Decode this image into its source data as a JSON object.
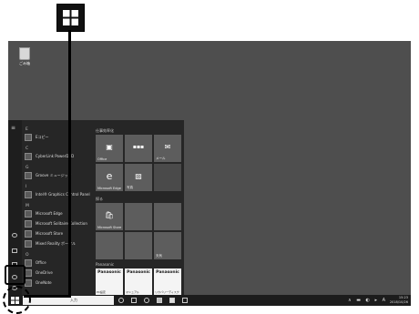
{
  "callout": {
    "icon": "windows-logo-icon"
  },
  "desktop": {
    "recycle_bin_label": "ごみ箱"
  },
  "start_menu": {
    "left_rail_icons": [
      "menu-icon",
      "user-icon",
      "document-icon",
      "pictures-icon",
      "settings-icon",
      "power-icon"
    ],
    "apps": [
      {
        "letter": "E",
        "items": [
          "Eコピー"
        ]
      },
      {
        "letter": "C",
        "items": [
          "CyberLink PowerDVD"
        ]
      },
      {
        "letter": "G",
        "items": [
          "Groove ミュージック"
        ]
      },
      {
        "letter": "I",
        "items": [
          "Intel® Graphics Control Panel"
        ]
      },
      {
        "letter": "M",
        "items": [
          "Microsoft Edge",
          "Microsoft Solitaire Collection",
          "Microsoft Store",
          "Mixed Reality ポータル"
        ]
      },
      {
        "letter": "O",
        "items": [
          "Office",
          "OneDrive",
          "OneNote"
        ]
      }
    ],
    "tile_groups": [
      {
        "title": "仕事効率化",
        "tiles": [
          "Office",
          "",
          "メール",
          "Microsoft Edge",
          "写真",
          ""
        ]
      },
      {
        "title": "探る",
        "tiles": [
          "Microsoft Store",
          "",
          "",
          "",
          "",
          "天気"
        ]
      },
      {
        "title": "Panasonic",
        "tiles": [
          {
            "brand": "Panasonic",
            "label": "PC設定"
          },
          {
            "brand": "Panasonic",
            "label": "マニュアル"
          },
          {
            "brand": "Panasonic",
            "label": "リカバリーディスク"
          }
        ]
      }
    ]
  },
  "taskbar": {
    "search_placeholder": "入力",
    "pinned_icons": [
      "cortana-icon",
      "task-view-icon",
      "edge-icon",
      "file-explorer-icon",
      "store-icon",
      "mail-icon"
    ],
    "tray_symbols": "∧ ▬ ◐ ▸ A",
    "time": "15:23",
    "date": "2018/10/26"
  }
}
